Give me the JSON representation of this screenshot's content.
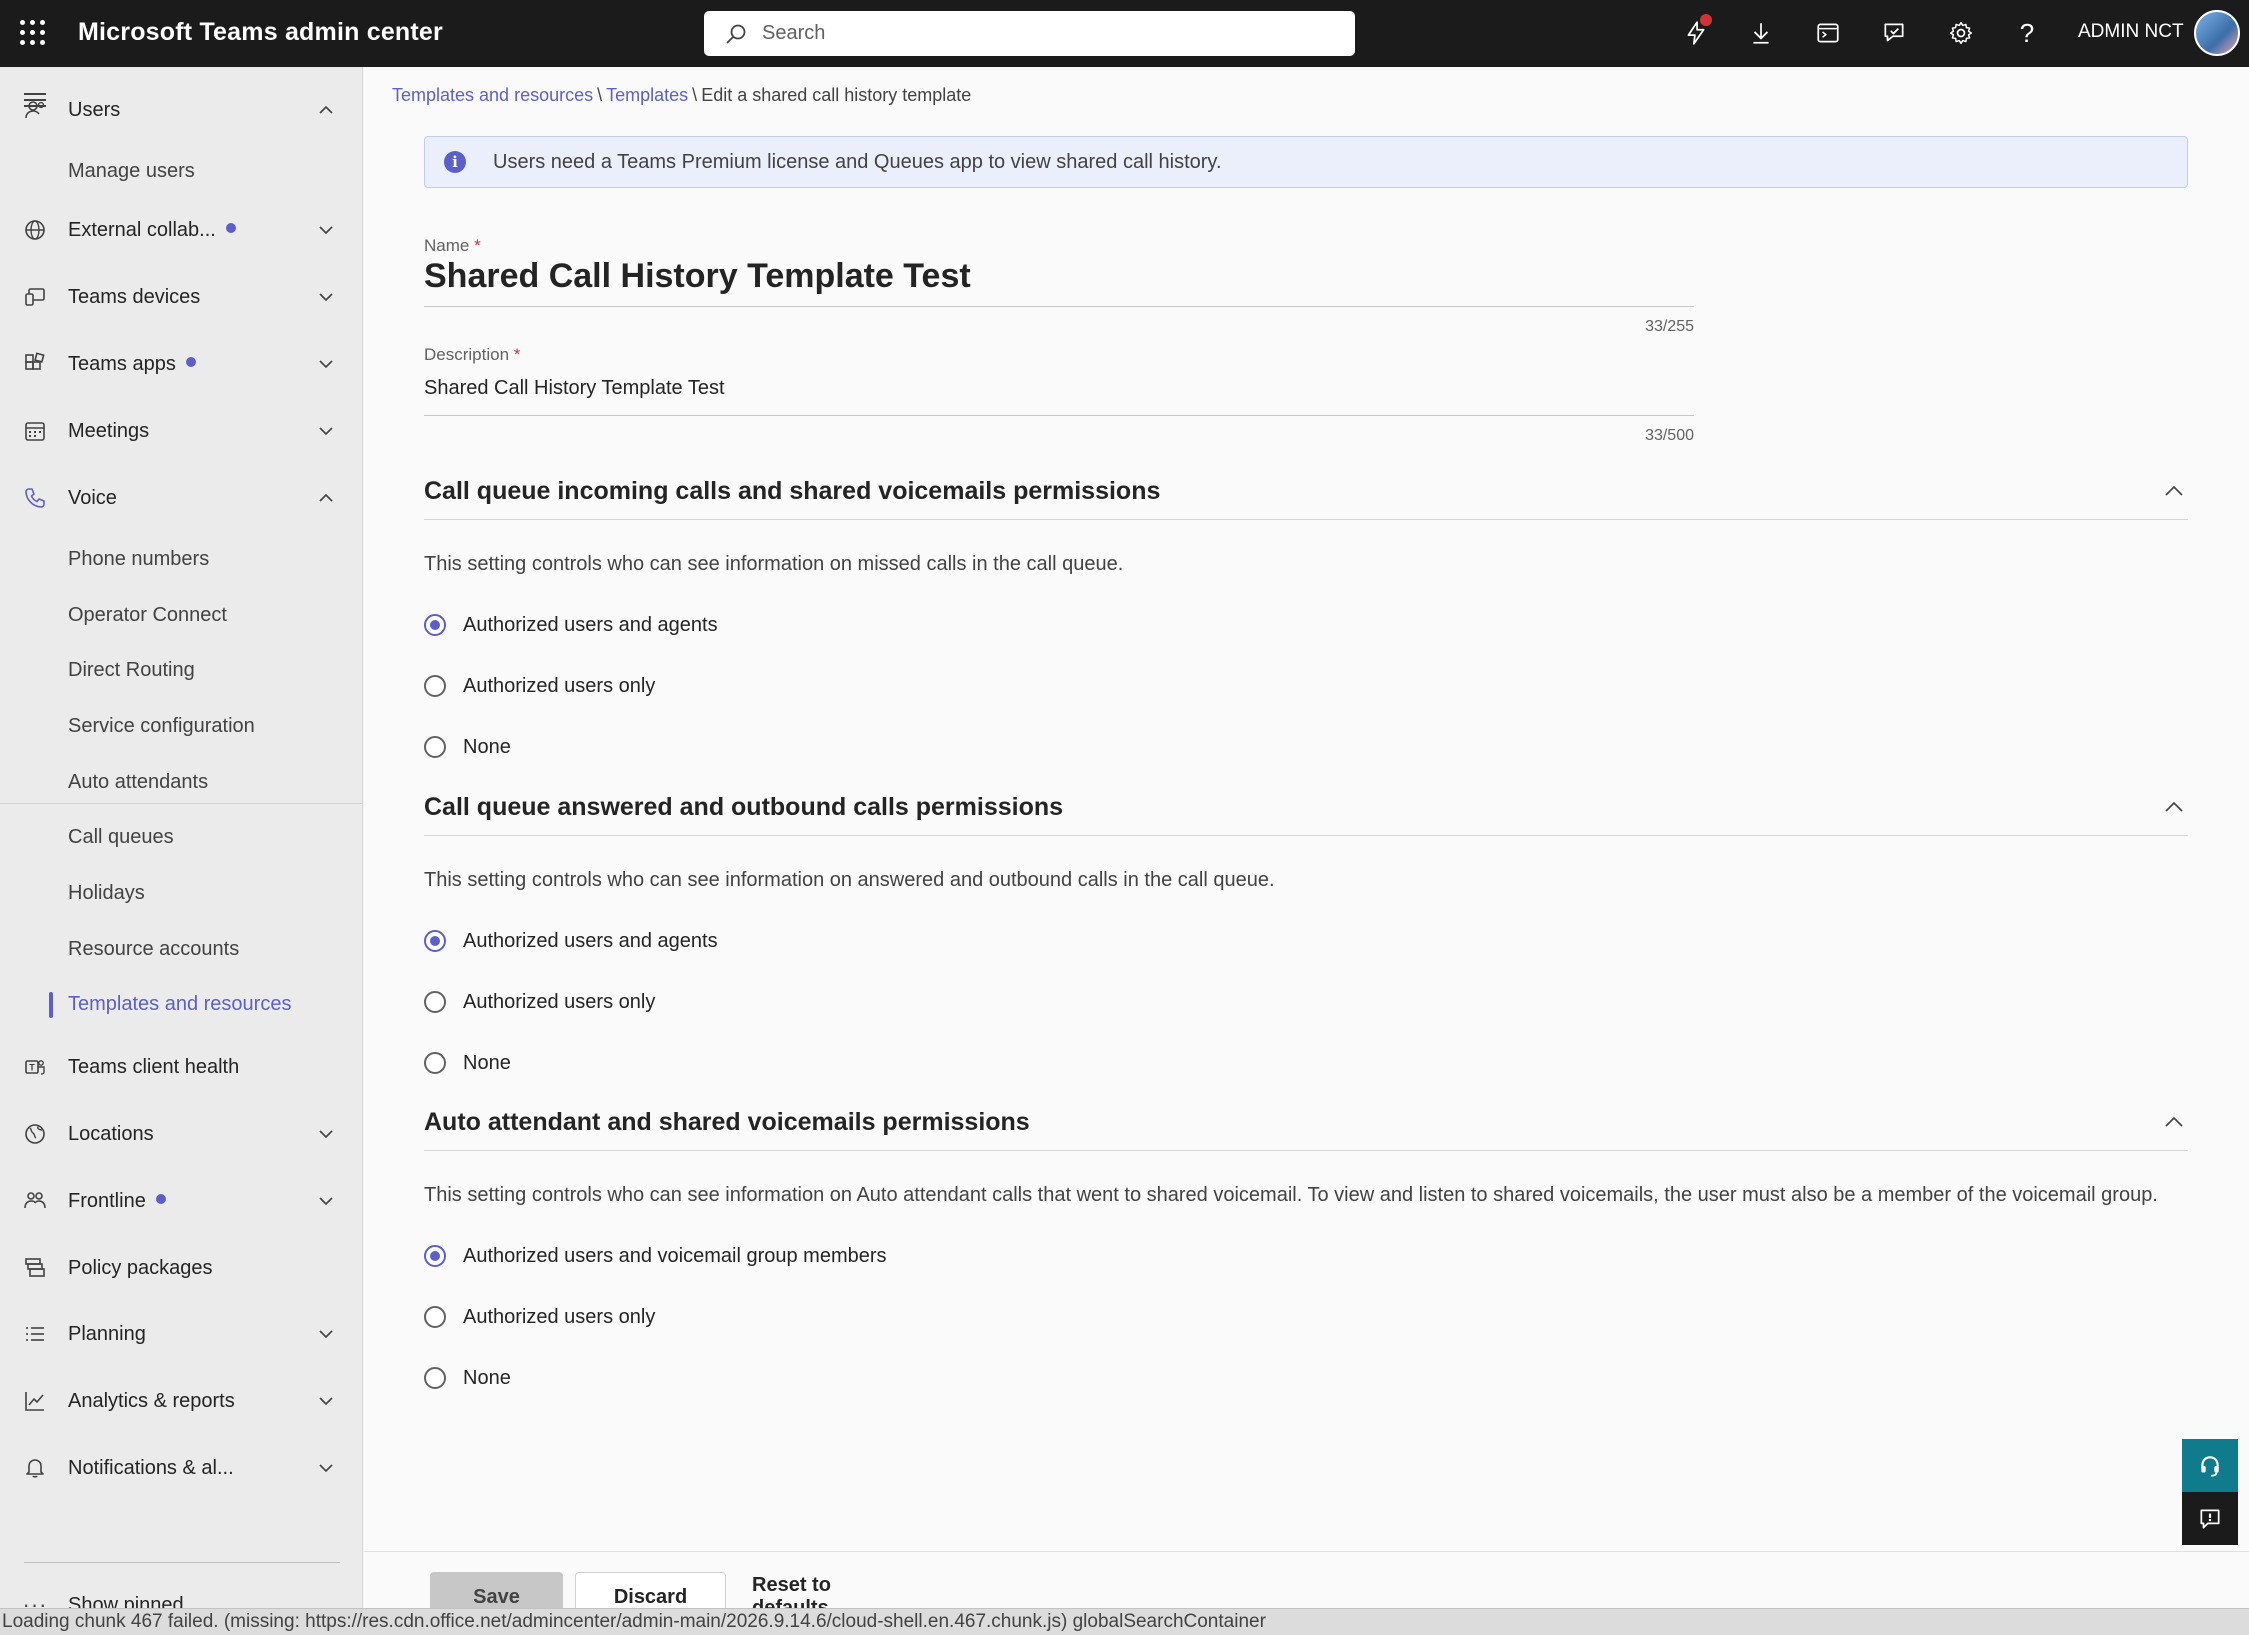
{
  "header": {
    "app_title": "Microsoft Teams admin center",
    "search_placeholder": "Search",
    "user_name": "ADMIN NCT",
    "icons": [
      "waffle-icon",
      "lightning-icon",
      "download-icon",
      "terminal-icon",
      "feedback-icon",
      "gear-icon",
      "help-icon"
    ]
  },
  "sidebar": {
    "items": [
      {
        "label": "Users",
        "expanded": true
      },
      {
        "label": "Manage users"
      },
      {
        "label": "External collab...",
        "dot": true
      },
      {
        "label": "Teams devices"
      },
      {
        "label": "Teams apps",
        "dot": true
      },
      {
        "label": "Meetings"
      },
      {
        "label": "Voice",
        "expanded": true
      },
      {
        "label": "Phone numbers"
      },
      {
        "label": "Operator Connect"
      },
      {
        "label": "Direct Routing"
      },
      {
        "label": "Service configuration"
      },
      {
        "label": "Auto attendants"
      },
      {
        "label": "Call queues"
      },
      {
        "label": "Holidays"
      },
      {
        "label": "Resource accounts"
      },
      {
        "label": "Templates and resources",
        "active": true
      },
      {
        "label": "Teams client health"
      },
      {
        "label": "Locations"
      },
      {
        "label": "Frontline",
        "dot": true
      },
      {
        "label": "Policy packages"
      },
      {
        "label": "Planning"
      },
      {
        "label": "Analytics & reports"
      },
      {
        "label": "Notifications & al..."
      },
      {
        "label": "Show pinned"
      }
    ]
  },
  "breadcrumb": {
    "level1": "Templates and resources",
    "sep": "\\",
    "level2": "Templates",
    "current": "Edit a shared call history template"
  },
  "banner": {
    "text": "Users need a Teams Premium license and Queues app to view shared call history."
  },
  "form": {
    "name_label": "Name",
    "required_mark": "*",
    "name_value": "Shared Call History Template Test",
    "name_counter": "33/255",
    "description_label": "Description",
    "description_value": "Shared Call History Template Test",
    "description_counter": "33/500"
  },
  "sections": [
    {
      "title": "Call queue incoming calls and shared voicemails permissions",
      "description": "This setting controls who can see information on missed calls in the call queue.",
      "options": [
        "Authorized users and agents",
        "Authorized users only",
        "None"
      ],
      "selected": 0
    },
    {
      "title": "Call queue answered and outbound calls permissions",
      "description": "This setting controls who can see information on answered and outbound calls in the call queue.",
      "options": [
        "Authorized users and agents",
        "Authorized users only",
        "None"
      ],
      "selected": 0
    },
    {
      "title": "Auto attendant and shared voicemails permissions",
      "description": "This setting controls who can see information on Auto attendant calls that went to shared voicemail. To view and listen to shared voicemails, the user must also be a member of the voicemail group.",
      "options": [
        "Authorized users and voicemail group members",
        "Authorized users only",
        "None"
      ],
      "selected": 0
    }
  ],
  "footer": {
    "save_label": "Save",
    "discard_label": "Discard",
    "reset_label": "Reset to defaults"
  },
  "status_bar": {
    "text": "Loading chunk 467 failed. (missing: https://res.cdn.office.net/admincenter/admin-main/2026.9.14.6/cloud-shell.en.467.chunk.js) globalSearchContainer"
  },
  "colors": {
    "accent": "#5b5fc7",
    "topbar": "#1b1b1b",
    "notification": "#d13438",
    "help_button": "#0f7b8c"
  }
}
